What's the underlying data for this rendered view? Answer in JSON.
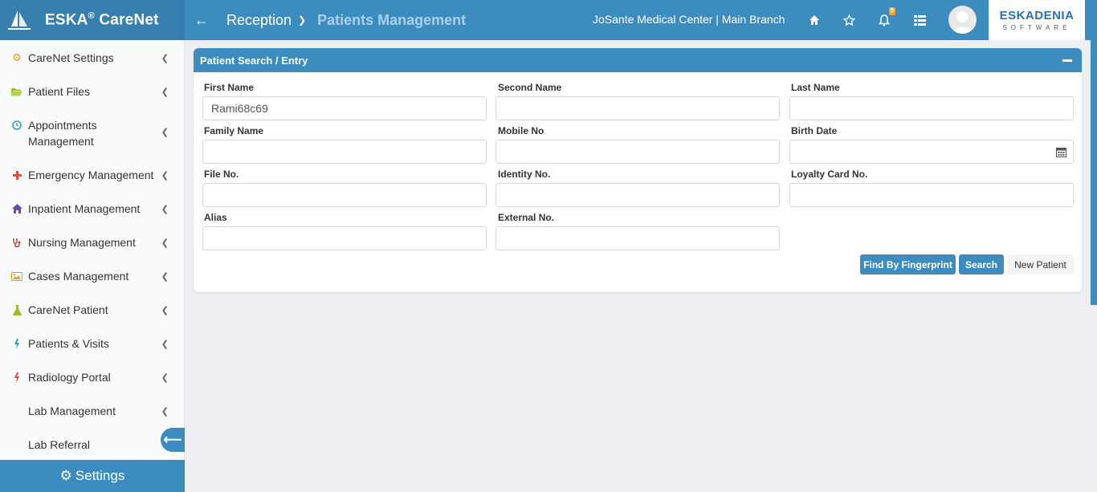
{
  "app": {
    "brand": "ESKA",
    "brand_reg": "®",
    "brand_suffix": "CareNet"
  },
  "header": {
    "module": "Reception",
    "page_title": "Patients Management",
    "branch": "JoSante Medical Center | Main Branch",
    "notification_count": "0",
    "company_logo_text": "ESKADENIA",
    "company_logo_sub": "SOFTWARE",
    "icons": [
      "home-icon",
      "star-icon",
      "bell-icon",
      "grid-icon"
    ]
  },
  "sidebar": {
    "items": [
      {
        "label": "CareNet Settings",
        "icon": "gear-icon",
        "color": "#f0932b"
      },
      {
        "label": "Patient Files",
        "icon": "folder-open-icon",
        "color": "#9bbf2e"
      },
      {
        "label": "Appointments Management",
        "icon": "clock-icon",
        "color": "#2a9fd6"
      },
      {
        "label": "Emergency Management",
        "icon": "plus-icon",
        "color": "#e74c3c"
      },
      {
        "label": "Inpatient Management",
        "icon": "home-icon",
        "color": "#6c4ab6"
      },
      {
        "label": "Nursing Management",
        "icon": "stethoscope-icon",
        "color": "#c0392b"
      },
      {
        "label": "Cases Management",
        "icon": "picture-icon",
        "color": "#e5a11a"
      },
      {
        "label": "CareNet Patient",
        "icon": "flask-icon",
        "color": "#9bbf2e"
      },
      {
        "label": "Patients & Visits",
        "icon": "bolt-icon",
        "color": "#2a9fd6"
      },
      {
        "label": "Radiology Portal",
        "icon": "bolt-icon",
        "color": "#e74c3c"
      },
      {
        "label": "Lab Management",
        "icon": "",
        "color": ""
      },
      {
        "label": "Lab Referral",
        "icon": "",
        "color": ""
      }
    ],
    "settings_label": "Settings"
  },
  "panel": {
    "title": "Patient Search / Entry",
    "fields": {
      "first_name": {
        "label": "First Name",
        "value": "Rami68c69"
      },
      "second_name": {
        "label": "Second Name",
        "value": ""
      },
      "last_name": {
        "label": "Last Name",
        "value": ""
      },
      "family_name": {
        "label": "Family Name",
        "value": ""
      },
      "mobile_no": {
        "label": "Mobile No",
        "value": ""
      },
      "birth_date": {
        "label": "Birth Date",
        "value": ""
      },
      "file_no": {
        "label": "File No.",
        "value": ""
      },
      "identity_no": {
        "label": "Identity No.",
        "value": ""
      },
      "loyalty_card_no": {
        "label": "Loyalty Card No.",
        "value": ""
      },
      "alias": {
        "label": "Alias",
        "value": ""
      },
      "external_no": {
        "label": "External No.",
        "value": ""
      }
    },
    "buttons": {
      "fingerprint": "Find By Fingerprint",
      "search": "Search",
      "new_patient": "New Patient"
    }
  },
  "colors": {
    "primary": "#3d8cc0",
    "brand_dark": "#357fb1",
    "page_bg": "#edeff2",
    "badge": "#f0a32e"
  }
}
